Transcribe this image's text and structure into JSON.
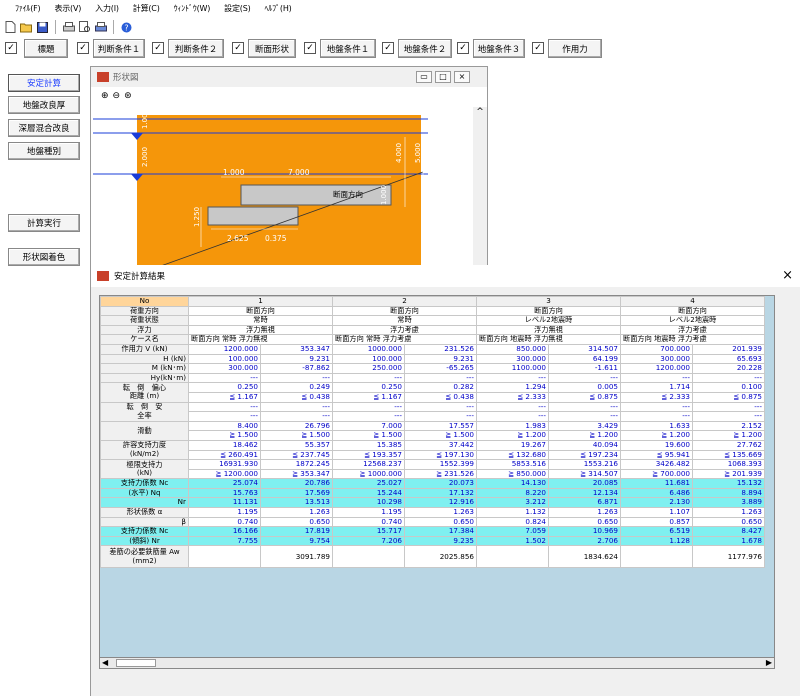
{
  "menu": [
    "ﾌｧｲﾙ(F)",
    "表示(V)",
    "入力(I)",
    "計算(C)",
    "ｳｨﾝﾄﾞｳ(W)",
    "設定(S)",
    "ﾍﾙﾌﾟ(H)"
  ],
  "tabs": [
    "標題",
    "判断条件１",
    "判断条件２",
    "断面形状",
    "地盤条件１",
    "地盤条件２",
    "地盤条件３",
    "作用力"
  ],
  "left_buttons": [
    "安定計算",
    "地盤改良厚",
    "深層混合改良",
    "地盤種別",
    "計算実行",
    "形状図着色"
  ],
  "shape_window": {
    "title": "形状図",
    "labels": {
      "l1000": "1.000",
      "l7000": "7.000",
      "l4000": "4.000",
      "l5000": "5.000",
      "l1250": "1.250",
      "l2625": "2.625",
      "l0375": "0.375",
      "l1000v": "1.000",
      "r1000": "1.000",
      "r2000": "2.000",
      "dir": "断面方向"
    }
  },
  "result_window": {
    "title": "安定計算結果",
    "close": "×"
  },
  "table": {
    "no_label": "No",
    "cases": [
      "1",
      "2",
      "3",
      "4"
    ],
    "direction": [
      "断面方向",
      "断面方向",
      "断面方向",
      "断面方向"
    ],
    "load_state": [
      "常時",
      "常時",
      "レベル2地震時",
      "レベル2地震時"
    ],
    "buoyancy": [
      "浮力無視",
      "浮力考慮",
      "浮力無視",
      "浮力考慮"
    ],
    "case_sub": "断面方向 常時 浮力無視",
    "case_sub_list": [
      "断面方向 常時 浮力無視",
      "断面方向 常時 浮力考慮",
      "断面方向 地震時 浮力無視",
      "断面方向 地震時 浮力考慮"
    ],
    "row_labels": {
      "dir": "荷重方向",
      "state": "荷重状態",
      "buoy": "浮力",
      "case": "ケース名",
      "V": "作用力 V (kN)",
      "H": "H (kN)",
      "M": "M (kN･m)",
      "Hy": "Hy(kN･m)",
      "ecc": "転　倒　偏心",
      "ecc2": "距離 (m)",
      "safe": "転　倒　安",
      "safe2": "全率",
      "slide": "滑動",
      "allow": "許容支持力度",
      "allow2": "(kN/m2)",
      "ult": "極限支持力",
      "ult2": "(kN)",
      "nc": "支持力係数 Nc",
      "nq": "(水平) Nq",
      "nr": "Nr",
      "alpha": "形状係数 α",
      "beta": "β",
      "nc2": "支持力係数 Nc",
      "nr2": "(傾斜) Nr",
      "aw": "差筋の必要鉄筋量 Aw",
      "aw2": "(mm2)"
    },
    "rows": {
      "V": [
        "1200.000",
        "353.347",
        "1000.000",
        "231.526",
        "850.000",
        "314.507",
        "700.000",
        "201.939"
      ],
      "H": [
        "100.000",
        "9.231",
        "100.000",
        "9.231",
        "300.000",
        "64.199",
        "300.000",
        "65.693"
      ],
      "M": [
        "300.000",
        "-87.862",
        "250.000",
        "-65.265",
        "1100.000",
        "-1.611",
        "1200.000",
        "20.228"
      ],
      "Hy": [
        "---",
        "---",
        "---",
        "---",
        "---",
        "---",
        "---",
        "---"
      ],
      "ecc_a": [
        "0.250",
        "0.249",
        "0.250",
        "0.282",
        "1.294",
        "0.005",
        "1.714",
        "0.100"
      ],
      "ecc_b": [
        "≦ 1.167",
        "≦ 0.438",
        "≦ 1.167",
        "≦ 0.438",
        "≦ 2.333",
        "≦ 0.875",
        "≦ 2.333",
        "≦ 0.875"
      ],
      "safe_a": [
        "---",
        "---",
        "---",
        "---",
        "---",
        "---",
        "---",
        "---"
      ],
      "safe_b": [
        "---",
        "---",
        "---",
        "---",
        "---",
        "---",
        "---",
        "---"
      ],
      "slide_a": [
        "8.400",
        "26.796",
        "7.000",
        "17.557",
        "1.983",
        "3.429",
        "1.633",
        "2.152"
      ],
      "slide_b": [
        "≧ 1.500",
        "≧ 1.500",
        "≧ 1.500",
        "≧ 1.500",
        "≧ 1.200",
        "≧ 1.200",
        "≧ 1.200",
        "≧ 1.200"
      ],
      "allow_a": [
        "18.462",
        "55.357",
        "15.385",
        "37.442",
        "19.267",
        "40.094",
        "19.600",
        "27.762"
      ],
      "allow_b": [
        "≦ 260.491",
        "≦ 237.745",
        "≦ 193.357",
        "≦ 197.130",
        "≦ 132.680",
        "≦ 197.234",
        "≦ 95.941",
        "≦ 135.669"
      ],
      "ult_a": [
        "16931.930",
        "1872.245",
        "12568.237",
        "1552.399",
        "5853.516",
        "1553.216",
        "3426.482",
        "1068.393"
      ],
      "ult_b": [
        "≧ 1200.000",
        "≧ 353.347",
        "≧ 1000.000",
        "≧ 231.526",
        "≧ 850.000",
        "≧ 314.507",
        "≧ 700.000",
        "≧ 201.939"
      ],
      "nc": [
        "25.074",
        "20.786",
        "25.027",
        "20.073",
        "14.130",
        "20.085",
        "11.681",
        "15.132"
      ],
      "nq": [
        "15.763",
        "17.569",
        "15.244",
        "17.132",
        "8.220",
        "12.134",
        "6.486",
        "8.894"
      ],
      "nr": [
        "11.131",
        "13.513",
        "10.298",
        "12.916",
        "3.212",
        "6.871",
        "2.130",
        "3.889"
      ],
      "alpha": [
        "1.195",
        "1.263",
        "1.195",
        "1.263",
        "1.132",
        "1.263",
        "1.107",
        "1.263"
      ],
      "beta": [
        "0.740",
        "0.650",
        "0.740",
        "0.650",
        "0.824",
        "0.650",
        "0.857",
        "0.650"
      ],
      "nc2": [
        "16.166",
        "17.819",
        "15.717",
        "17.384",
        "7.059",
        "10.969",
        "6.519",
        "8.427"
      ],
      "nr2": [
        "7.755",
        "9.754",
        "7.206",
        "9.235",
        "1.502",
        "2.706",
        "1.128",
        "1.678"
      ],
      "aw": [
        "",
        "3091.789",
        "",
        "2025.856",
        "",
        "1834.624",
        "",
        "1177.976"
      ]
    }
  }
}
